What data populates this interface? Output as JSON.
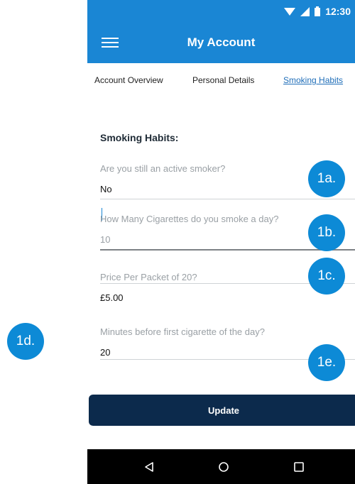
{
  "status_bar": {
    "time": "12:30"
  },
  "app_bar": {
    "title": "My Account",
    "menu_icon": "hamburger-menu-icon"
  },
  "tabs": [
    {
      "label": "Account Overview",
      "active": false
    },
    {
      "label": "Personal Details",
      "active": false
    },
    {
      "label": "Smoking Habits",
      "active": true
    }
  ],
  "form": {
    "section_title": "Smoking Habits:",
    "fields": [
      {
        "question": "Are you still an active smoker?",
        "value": "No"
      },
      {
        "question": "How Many Cigarettes do you smoke a day?",
        "value": "10"
      },
      {
        "question": "Price Per Packet of 20?",
        "value": "£5.00"
      },
      {
        "question": "Minutes before first cigarette of the day?",
        "value": "20"
      }
    ],
    "update_label": "Update"
  },
  "annotations": [
    "1a.",
    "1b.",
    "1c.",
    "1d.",
    "1e."
  ],
  "colors": {
    "primary": "#1a86d4",
    "button": "#0c2a4c",
    "badge": "#0d8ad6",
    "active_tab": "#1e6db8"
  }
}
